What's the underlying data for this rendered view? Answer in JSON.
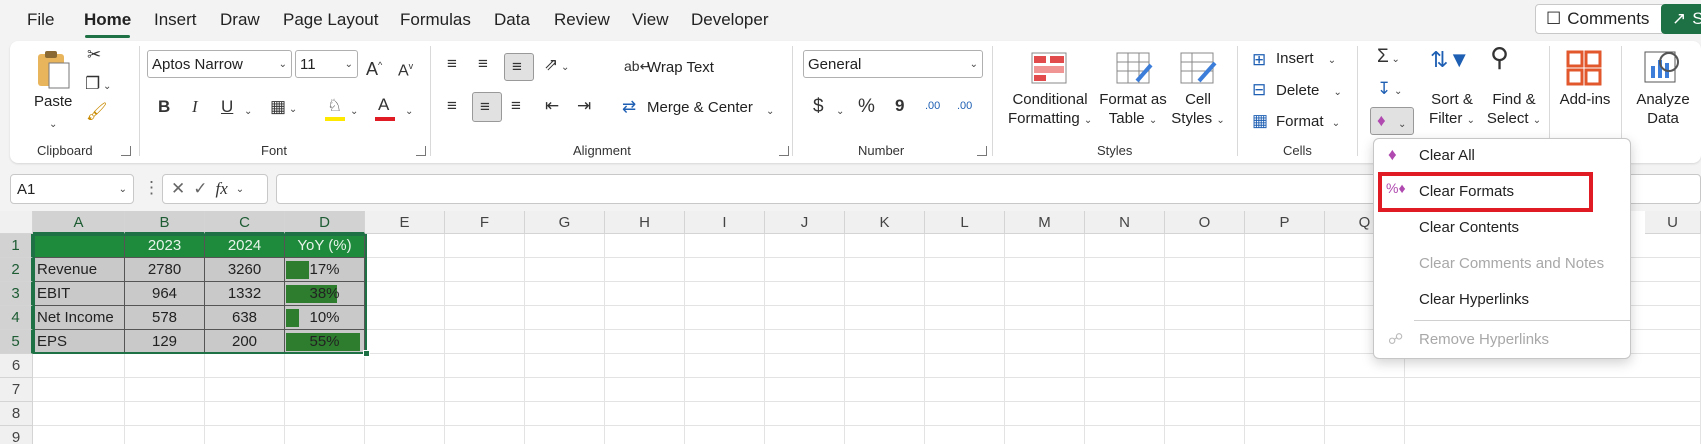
{
  "tabs": [
    "File",
    "Home",
    "Insert",
    "Draw",
    "Page Layout",
    "Formulas",
    "Data",
    "Review",
    "View",
    "Developer"
  ],
  "active_tab": "Home",
  "top_buttons": {
    "comments": "Comments",
    "share": "Sh"
  },
  "ribbon": {
    "clipboard": {
      "label": "Clipboard",
      "paste": "Paste"
    },
    "font": {
      "label": "Font",
      "family": "Aptos Narrow",
      "size": "11",
      "bold": "B",
      "italic": "I",
      "underline": "U",
      "grow": "A",
      "shrink": "A"
    },
    "alignment": {
      "label": "Alignment",
      "wrap": "Wrap Text",
      "merge": "Merge & Center"
    },
    "number": {
      "label": "Number",
      "format": "General",
      "currency": "$",
      "percent": "%",
      "comma": "9",
      "inc_decimal": ".00",
      "dec_decimal": ".00"
    },
    "styles": {
      "label": "Styles",
      "conditional": [
        "Conditional",
        "Formatting"
      ],
      "format_table": [
        "Format as",
        "Table"
      ],
      "cell_styles": [
        "Cell",
        "Styles"
      ]
    },
    "cells": {
      "label": "Cells",
      "insert": "Insert",
      "delete": "Delete",
      "format": "Format"
    },
    "editing": {
      "sort": [
        "Sort &",
        "Filter"
      ],
      "find": [
        "Find &",
        "Select"
      ]
    },
    "addins": "Add-ins",
    "analyze": [
      "Analyze",
      "Data"
    ]
  },
  "formula_bar": {
    "name_box": "A1",
    "fx": "fx",
    "formula": ""
  },
  "sheet": {
    "columns": [
      "A",
      "B",
      "C",
      "D",
      "E",
      "F",
      "G",
      "H",
      "I",
      "J",
      "K",
      "L",
      "M",
      "N",
      "O",
      "P",
      "Q",
      "U"
    ],
    "rows": [
      "1",
      "2",
      "3",
      "4",
      "5",
      "6",
      "7",
      "8",
      "9"
    ],
    "table": {
      "headers": [
        "",
        "2023",
        "2024",
        "YoY (%)"
      ],
      "data": [
        {
          "label": "Revenue",
          "y2023": "2780",
          "y2024": "3260",
          "yoy": "17%",
          "yoy_value": 0.17
        },
        {
          "label": "EBIT",
          "y2023": "964",
          "y2024": "1332",
          "yoy": "38%",
          "yoy_value": 0.38
        },
        {
          "label": "Net Income",
          "y2023": "578",
          "y2024": "638",
          "yoy": "10%",
          "yoy_value": 0.1
        },
        {
          "label": "EPS",
          "y2023": "129",
          "y2024": "200",
          "yoy": "55%",
          "yoy_value": 0.55
        }
      ]
    }
  },
  "clear_menu": {
    "items": [
      {
        "label": "Clear All",
        "enabled": true
      },
      {
        "label": "Clear Formats",
        "enabled": true,
        "highlighted": true
      },
      {
        "label": "Clear Contents",
        "enabled": true
      },
      {
        "label": "Clear Comments and Notes",
        "enabled": false
      },
      {
        "label": "Clear Hyperlinks",
        "enabled": true
      },
      {
        "label": "Remove Hyperlinks",
        "enabled": false
      }
    ]
  },
  "colors": {
    "accent": "#1e7145",
    "header_fill": "#1e8a3c",
    "databar": "#2e7d2e",
    "highlight": "#e01b24"
  }
}
